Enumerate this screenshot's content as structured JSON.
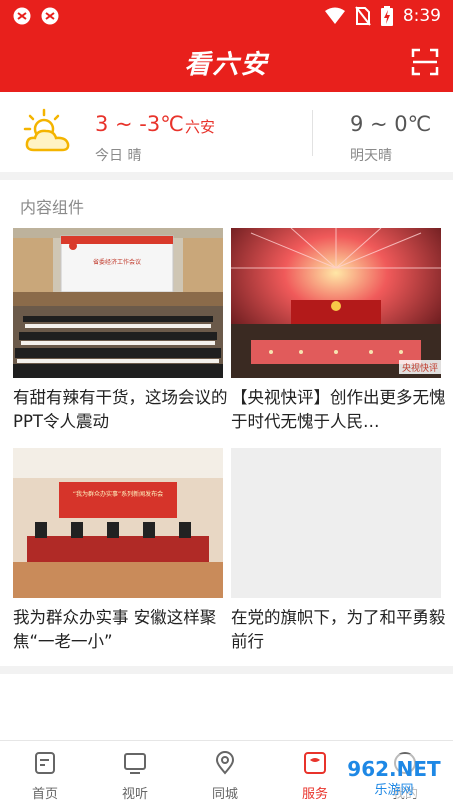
{
  "status_bar": {
    "time": "8:39"
  },
  "header": {
    "title": "看六安"
  },
  "weather": {
    "today_temp": "3 ~ -3℃",
    "city": "六安",
    "today_label": "今日 晴",
    "tomorrow_temp": "9 ~ 0℃",
    "tomorrow_label": "明天晴"
  },
  "section": {
    "title": "内容组件"
  },
  "cards": [
    {
      "title": "有甜有辣有干货，这场会议的PPT令人震动",
      "screen_text": "省委经济工作会议"
    },
    {
      "title": "【央视快评】创作出更多无愧于时代无愧于人民…",
      "badge": "央视快评"
    },
    {
      "title": "我为群众办实事 安徽这样聚焦“一老一小”",
      "banner_text": "“我为群众办实事”系列新闻发布会"
    },
    {
      "title": "在党的旗帜下，为了和平勇毅前行"
    }
  ],
  "nav": [
    {
      "label": "首页"
    },
    {
      "label": "视听"
    },
    {
      "label": "同城"
    },
    {
      "label": "服务"
    },
    {
      "label": "我的"
    }
  ],
  "watermark": {
    "text": "962.NET",
    "sub": "乐游网"
  },
  "colors": {
    "brand_red": "#e8201c",
    "accent_red": "#e8332b"
  }
}
